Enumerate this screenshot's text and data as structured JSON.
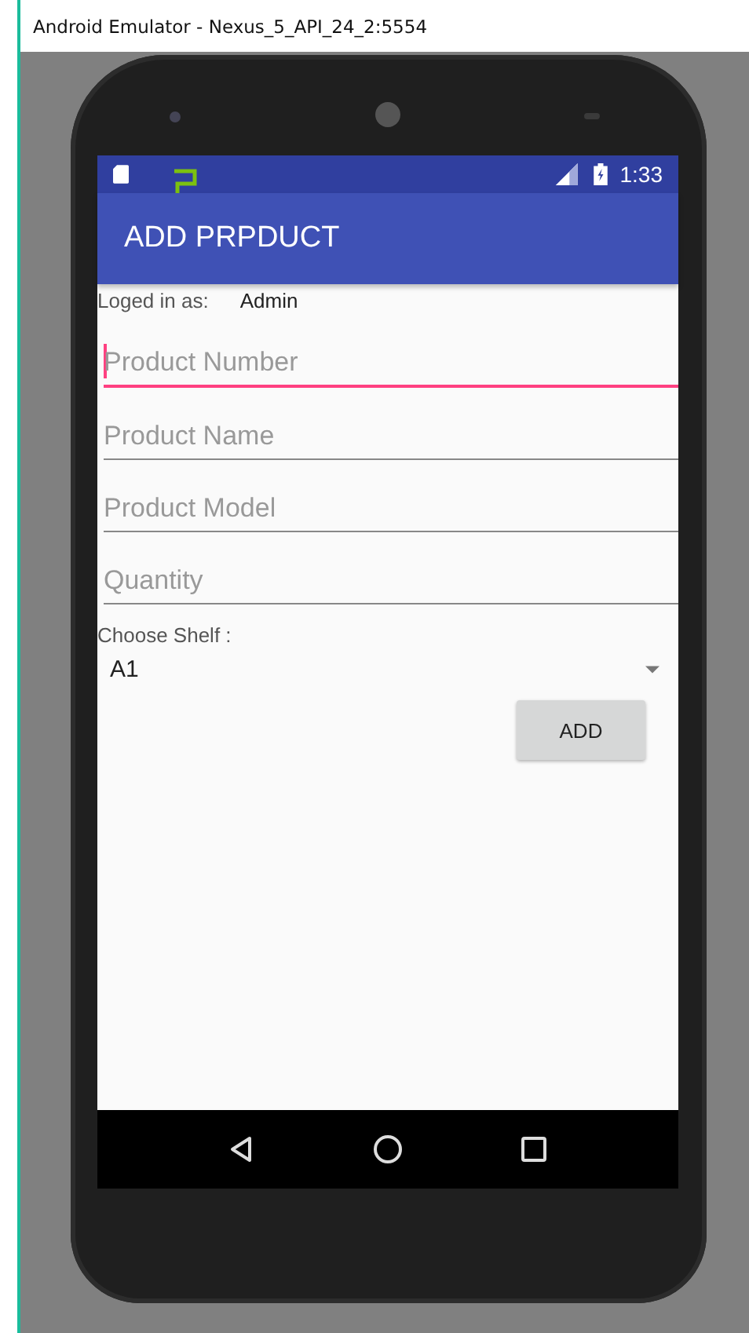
{
  "window": {
    "title": "Android Emulator - Nexus_5_API_24_2:5554"
  },
  "status_bar": {
    "time": "1:33"
  },
  "app_bar": {
    "title": "ADD PRPDUCT"
  },
  "login": {
    "label": "Loged in as:",
    "user": "Admin"
  },
  "fields": [
    {
      "placeholder": "Product Number",
      "focused": true
    },
    {
      "placeholder": "Product Name",
      "focused": false
    },
    {
      "placeholder": "Product Model",
      "focused": false
    },
    {
      "placeholder": "Quantity",
      "focused": false
    }
  ],
  "shelf": {
    "label": "Choose Shelf :",
    "value": "A1"
  },
  "add_button": {
    "label": "ADD"
  }
}
